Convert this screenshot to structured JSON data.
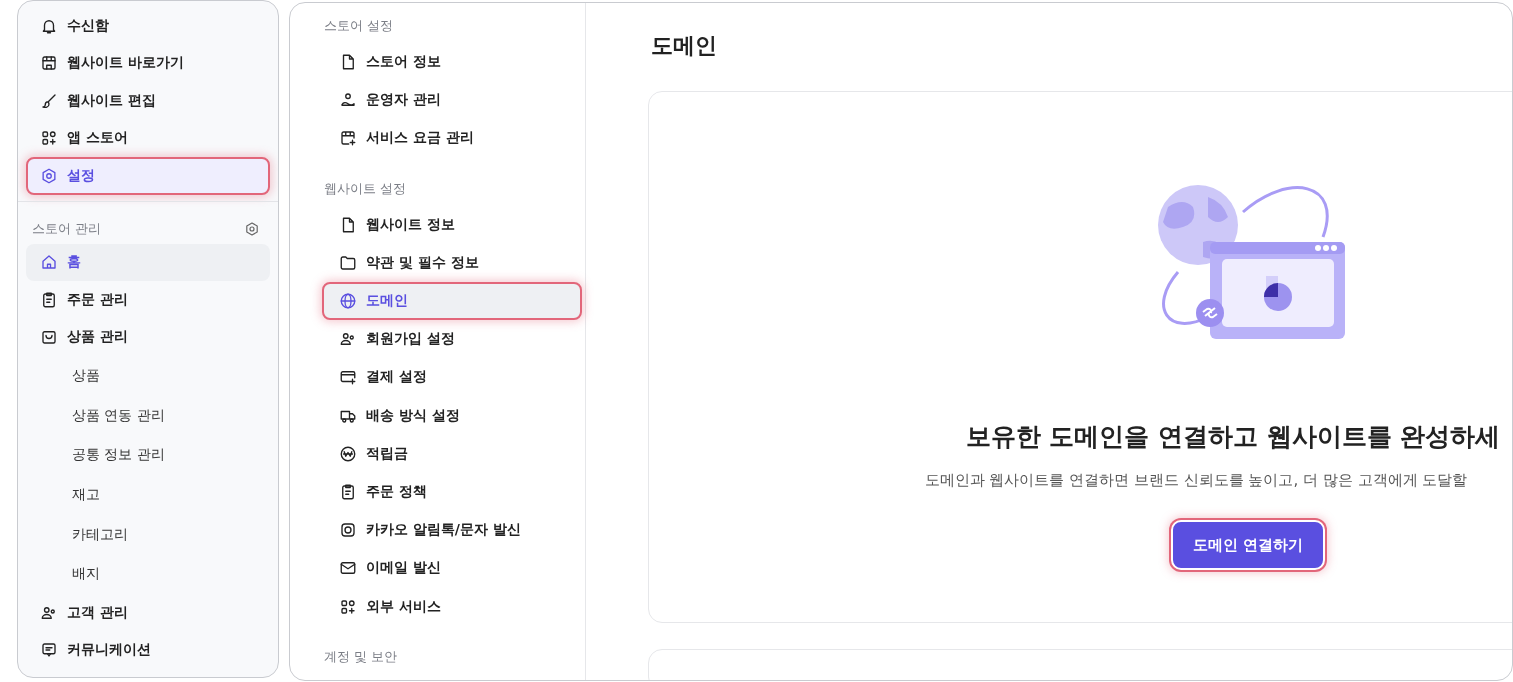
{
  "sidebar": {
    "top_items": [
      {
        "label": "수신함",
        "selected": false,
        "highlighted": false
      },
      {
        "label": "웹사이트 바로가기",
        "selected": false,
        "highlighted": false
      },
      {
        "label": "웹사이트 편집",
        "selected": false,
        "highlighted": false
      },
      {
        "label": "앱 스토어",
        "selected": false,
        "highlighted": false
      },
      {
        "label": "설정",
        "selected": true,
        "highlighted": true
      }
    ],
    "section": {
      "title": "스토어 관리",
      "items": [
        {
          "label": "홈",
          "selected": true,
          "highlighted": false
        },
        {
          "label": "주문 관리",
          "selected": false,
          "highlighted": false
        },
        {
          "label": "상품 관리",
          "selected": false,
          "highlighted": false,
          "children": [
            {
              "label": "상품",
              "selected": false
            },
            {
              "label": "상품 연동 관리",
              "selected": false
            },
            {
              "label": "공통 정보 관리",
              "selected": false
            },
            {
              "label": "재고",
              "selected": false
            },
            {
              "label": "카테고리",
              "selected": false
            },
            {
              "label": "배지",
              "selected": false
            }
          ]
        },
        {
          "label": "고객 관리",
          "selected": false,
          "highlighted": false
        },
        {
          "label": "커뮤니케이션",
          "selected": false,
          "highlighted": false
        }
      ]
    }
  },
  "settings_nav": {
    "sections": [
      {
        "title": "스토어 설정",
        "items": [
          {
            "label": "스토어 정보",
            "selected": false,
            "highlighted": false
          },
          {
            "label": "운영자 관리",
            "selected": false,
            "highlighted": false
          },
          {
            "label": "서비스 요금 관리",
            "selected": false,
            "highlighted": false
          }
        ]
      },
      {
        "title": "웹사이트 설정",
        "items": [
          {
            "label": "웹사이트 정보",
            "selected": false,
            "highlighted": false
          },
          {
            "label": "약관 및 필수 정보",
            "selected": false,
            "highlighted": false
          },
          {
            "label": "도메인",
            "selected": true,
            "highlighted": true
          },
          {
            "label": "회원가입 설정",
            "selected": false,
            "highlighted": false
          },
          {
            "label": "결제 설정",
            "selected": false,
            "highlighted": false
          },
          {
            "label": "배송 방식 설정",
            "selected": false,
            "highlighted": false
          },
          {
            "label": "적립금",
            "selected": false,
            "highlighted": false
          },
          {
            "label": "주문 정책",
            "selected": false,
            "highlighted": false
          },
          {
            "label": "카카오 알림톡/문자 발신",
            "selected": false,
            "highlighted": false
          },
          {
            "label": "이메일 발신",
            "selected": false,
            "highlighted": false
          },
          {
            "label": "외부 서비스",
            "selected": false,
            "highlighted": false
          }
        ]
      },
      {
        "title": "계정 및 보안"
      }
    ]
  },
  "main": {
    "title": "도메인",
    "empty_state": {
      "heading": "보유한 도메인을 연결하고 웹사이트를 완성하세",
      "description": "도메인과 웹사이트를 연결하면 브랜드 신뢰도를 높이고, 더 많은 고객에게 도달할",
      "button": {
        "label": "도메인 연결하기",
        "highlighted": true
      }
    }
  }
}
